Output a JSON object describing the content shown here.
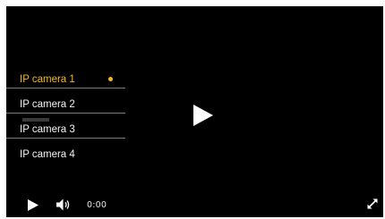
{
  "cameras": [
    {
      "label": "IP camera 1",
      "active": true
    },
    {
      "label": "IP camera 2",
      "active": false
    },
    {
      "label": "IP camera 3",
      "active": false
    },
    {
      "label": "IP camera 4",
      "active": false
    }
  ],
  "player": {
    "time": "0:00",
    "icons": {
      "big_play": "play-icon",
      "play": "play-icon",
      "volume": "volume-icon",
      "fullscreen": "fullscreen-icon"
    }
  },
  "colors": {
    "background": "#000000",
    "accent": "#f3b81a",
    "text": "#f2f2f2",
    "separator": "#7a7a7a"
  }
}
